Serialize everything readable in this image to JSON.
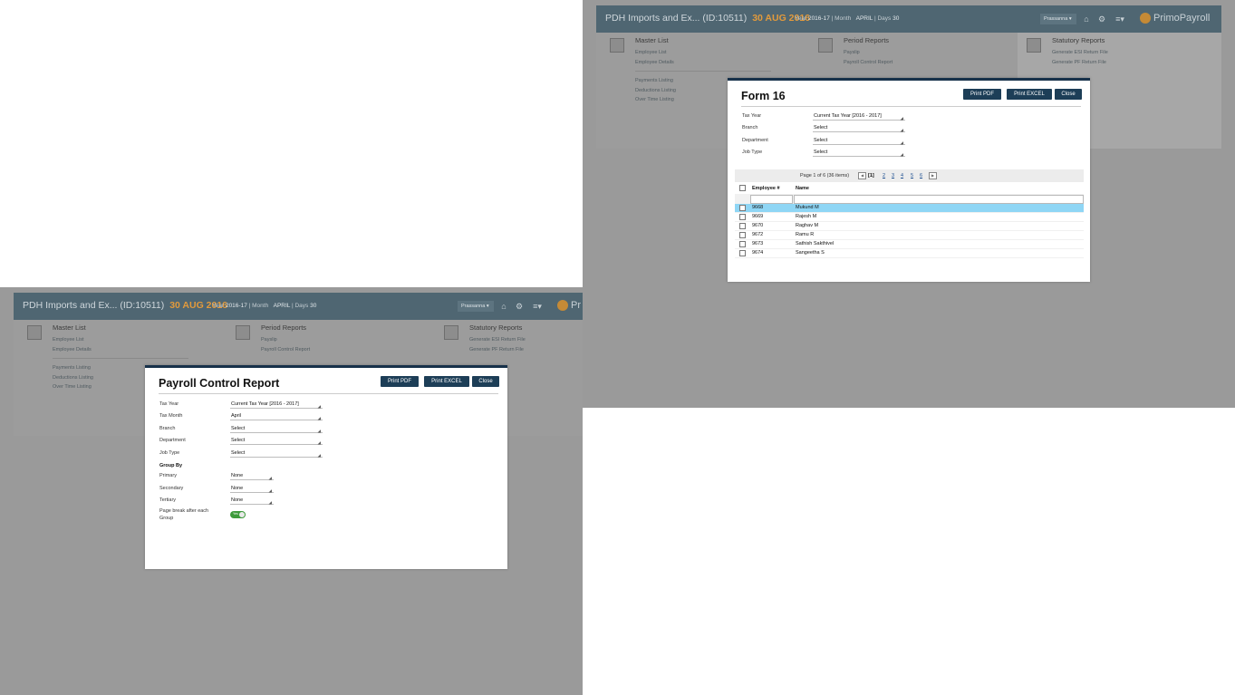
{
  "app": {
    "company": "PDH Imports and Ex... (ID:10511)",
    "date": "30 AUG 2016",
    "year_label": "Year",
    "year_value": "2016-17",
    "month_label": "Month",
    "month_value": "APRIL",
    "days_label": "Days",
    "days_value": "30",
    "user": "Prassanna",
    "logo_text": "PrimoPayroll",
    "logo_text_cut": "Pr"
  },
  "menus": {
    "master": {
      "title": "Master List",
      "items": [
        "Employee List",
        "Employee Details",
        "Payments Listing",
        "Deductions Listing",
        "Over Time Listing"
      ]
    },
    "period": {
      "title": "Period Reports",
      "items": [
        "Payslip",
        "Payroll Control Report"
      ]
    },
    "statutory": {
      "title": "Statutory Reports",
      "items": [
        "Generate ESI Return File",
        "Generate PF Return File"
      ]
    }
  },
  "form16": {
    "title": "Form 16",
    "buttons": {
      "pdf": "Print PDF",
      "excel": "Print EXCEL",
      "close": "Close"
    },
    "fields": [
      {
        "label": "Tax Year",
        "value": "Current Tax Year [2016 - 2017]"
      },
      {
        "label": "Branch",
        "value": "Select"
      },
      {
        "label": "Department",
        "value": "Select"
      },
      {
        "label": "Job Type",
        "value": "Select"
      }
    ],
    "pager": {
      "text": "Page 1 of 6 (36 items)",
      "current": "[1]",
      "pages": [
        "2",
        "3",
        "4",
        "5",
        "6"
      ]
    },
    "columns": {
      "emp": "Employee #",
      "name": "Name"
    },
    "rows": [
      {
        "emp": "9668",
        "name": "Mukund M",
        "selected": true
      },
      {
        "emp": "9669",
        "name": "Rajesh M"
      },
      {
        "emp": "9670",
        "name": "Raghav M"
      },
      {
        "emp": "9672",
        "name": "Ramu R"
      },
      {
        "emp": "9673",
        "name": "Sathish Sakthivel"
      },
      {
        "emp": "9674",
        "name": "Sangeetha S"
      }
    ]
  },
  "payroll": {
    "title": "Payroll Control Report",
    "buttons": {
      "pdf": "Print PDF",
      "excel": "Print EXCEL",
      "close": "Close"
    },
    "fields": [
      {
        "label": "Tax Year",
        "value": "Current Tax Year [2016 - 2017]"
      },
      {
        "label": "Tax Month",
        "value": "April"
      },
      {
        "label": "Branch",
        "value": "Select"
      },
      {
        "label": "Department",
        "value": "Select"
      },
      {
        "label": "Job Type",
        "value": "Select"
      }
    ],
    "group_by_label": "Group By",
    "group_fields": [
      {
        "label": "Primary",
        "value": "None"
      },
      {
        "label": "Secondary",
        "value": "None"
      },
      {
        "label": "Tertiary",
        "value": "None"
      }
    ],
    "page_break_label_1": "Page break after each",
    "page_break_label_2": "Group",
    "toggle_text": "Yes"
  },
  "colors": {
    "accent": "#17314a",
    "button": "#1d3e57",
    "date": "#e29a3c",
    "selected_row": "#8fd6f5",
    "toggle": "#3d9a3b"
  }
}
